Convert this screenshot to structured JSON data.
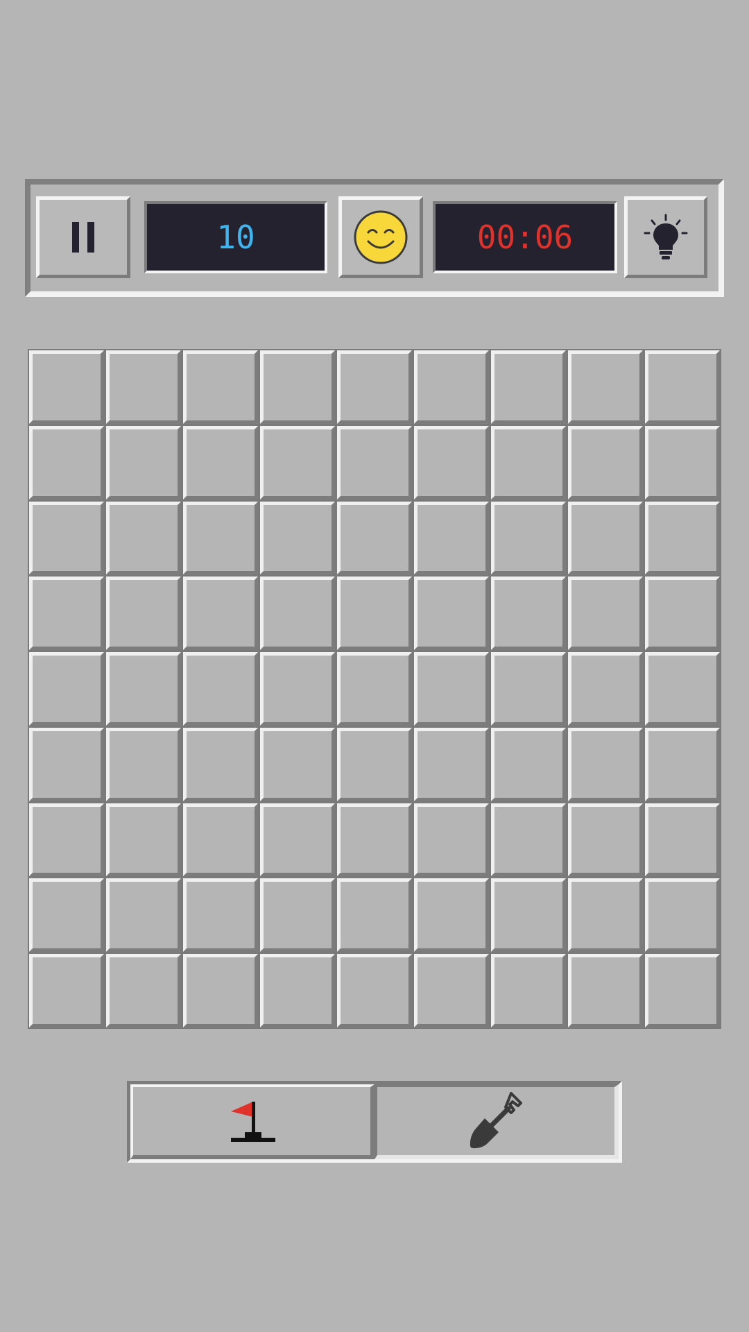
{
  "status": {
    "mines_remaining": "10",
    "timer": "00:06",
    "face": "smiley-face-icon"
  },
  "controls": {
    "pause_icon": "pause-icon",
    "hint_icon": "lightbulb-icon"
  },
  "board": {
    "rows": 9,
    "cols": 9,
    "cells_state": "all-unrevealed"
  },
  "mode_toggle": {
    "options": [
      {
        "icon": "flag-icon",
        "selected": false
      },
      {
        "icon": "shovel-icon",
        "selected": true
      }
    ]
  },
  "colors": {
    "background": "#b5b5b5",
    "lcd_background": "#25222f",
    "mine_counter": "#3fb4ee",
    "timer": "#e0312a",
    "face": "#f7d73a",
    "flag": "#e0312a"
  }
}
